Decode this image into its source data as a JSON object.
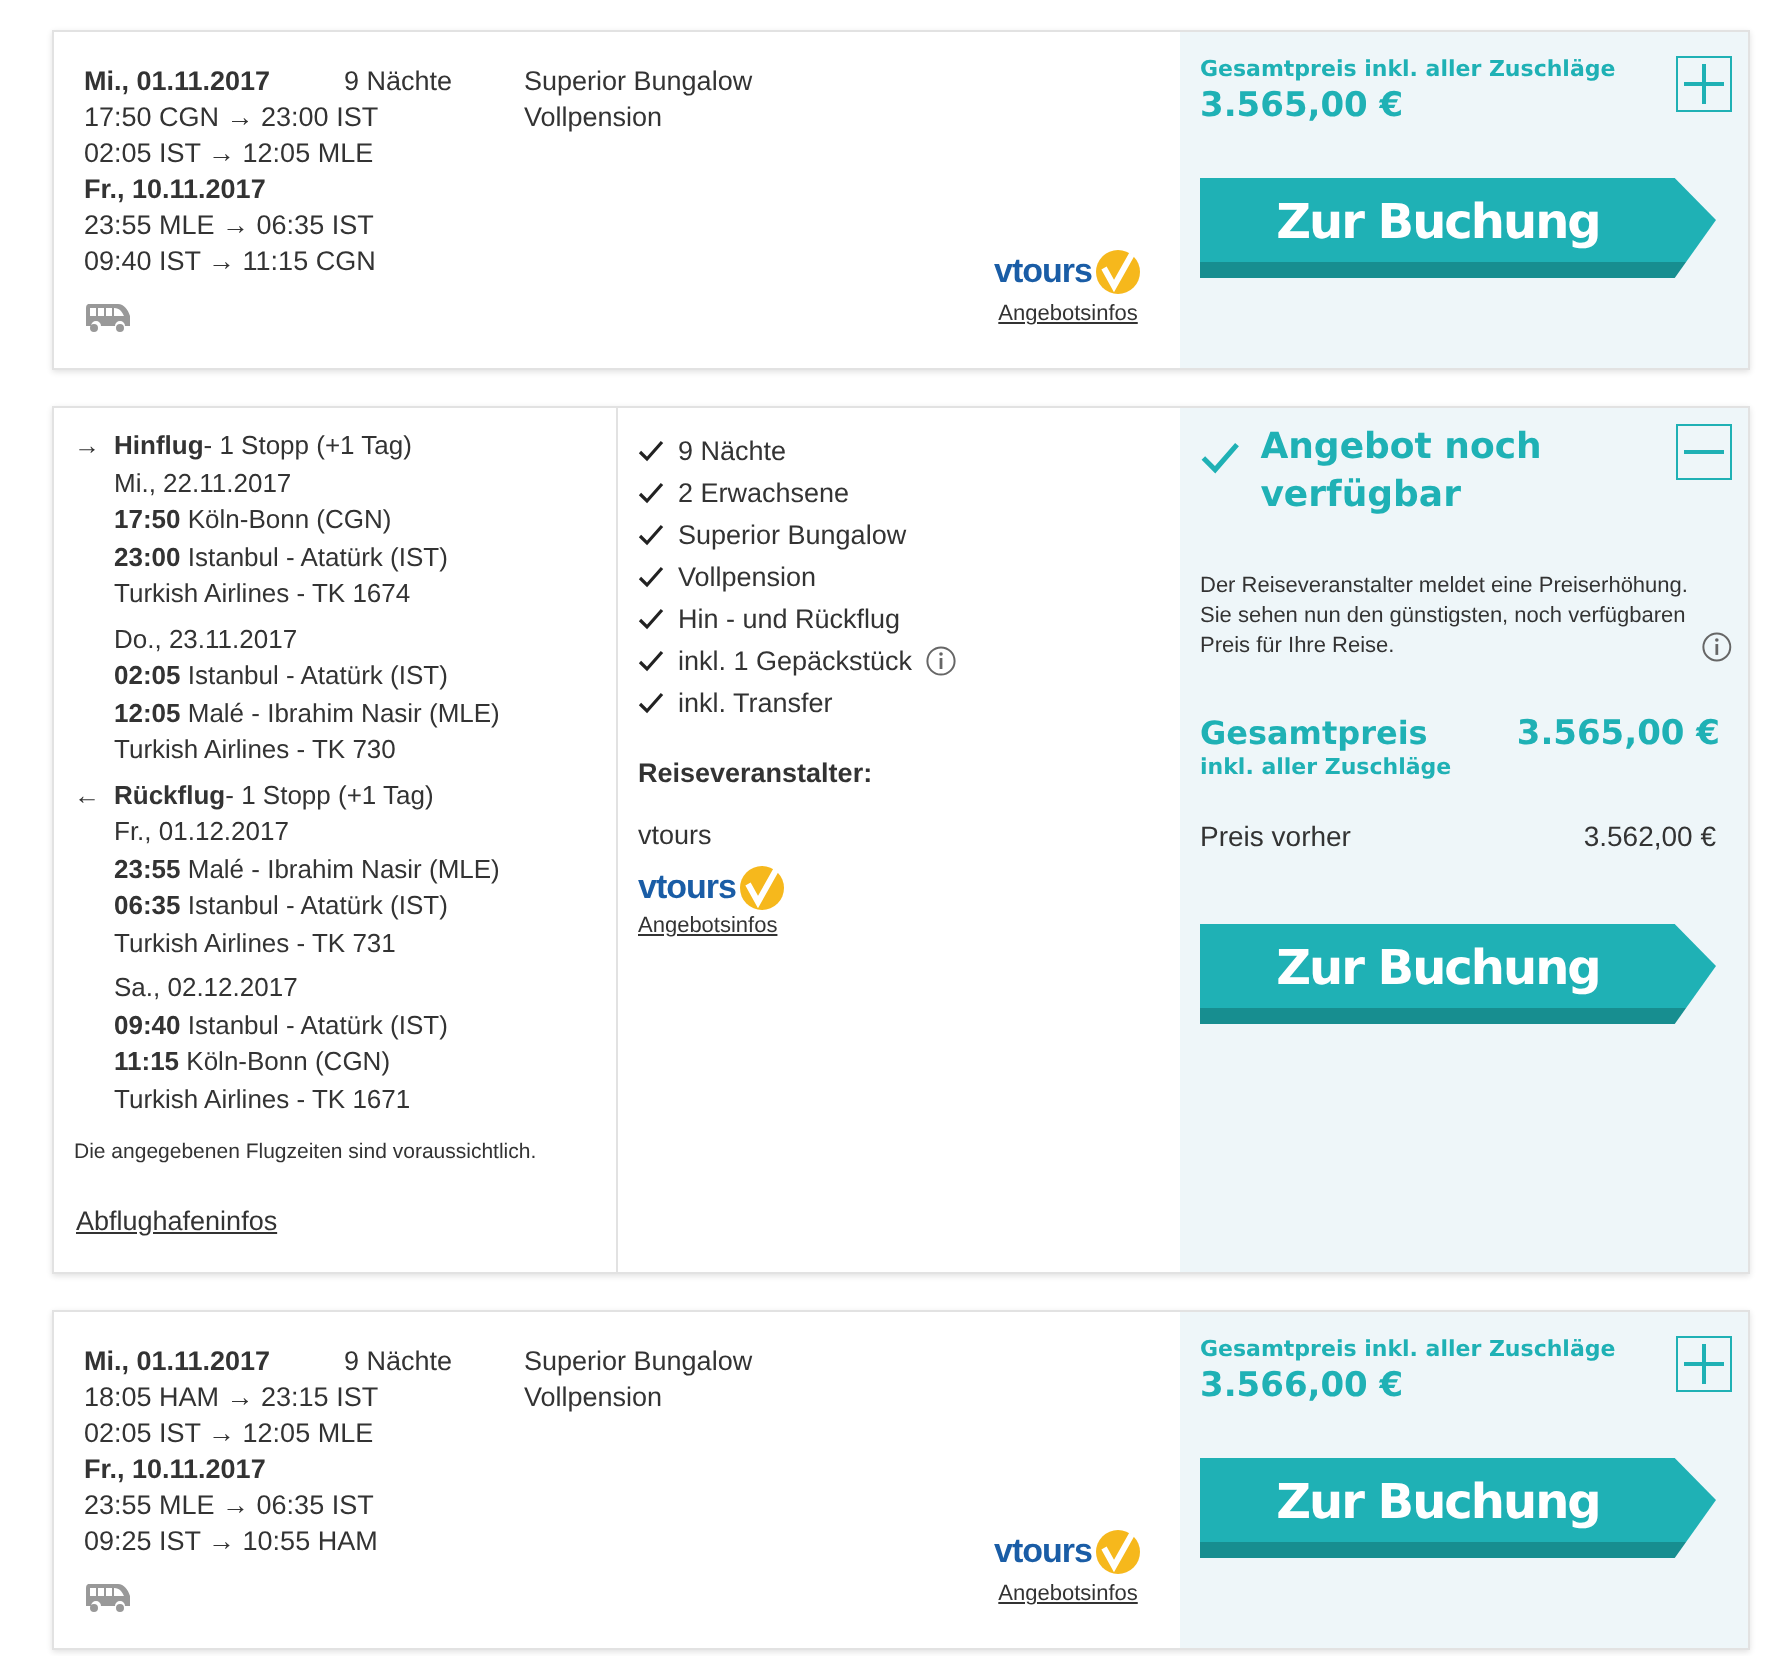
{
  "offers": [
    {
      "kind": "summary",
      "expanded": false,
      "date_out": "Mi., 01.11.2017",
      "nights": "9 Nächte",
      "legs_out": [
        "17:50 CGN → 23:00 IST",
        "02:05 IST → 12:05 MLE"
      ],
      "date_back": "Fr., 10.11.2017",
      "legs_back": [
        "23:55 MLE → 06:35 IST",
        "09:40 IST → 11:15 CGN"
      ],
      "room": "Superior Bungalow",
      "board": "Vollpension",
      "logo_text": "vtours",
      "info_link": "Angebotsinfos",
      "price_label": "Gesamtpreis inkl. aller Zuschläge",
      "price": "3.565,00 €",
      "button": "Zur Buchung"
    },
    {
      "kind": "detail",
      "expanded": true,
      "flights": [
        {
          "arrow": "→",
          "heading": "**Hinflug**- 1 Stopp (+1 Tag)",
          "segments": [
            {
              "date": "Mi., 22.11.2017",
              "lines": [
                "**17:50** Köln-Bonn (CGN)",
                "**23:00** Istanbul - Atatürk (IST)"
              ],
              "airline": "Turkish Airlines - TK 1674"
            },
            {
              "date": "Do., 23.11.2017",
              "lines": [
                "**02:05** Istanbul - Atatürk (IST)",
                "**12:05** Malé - Ibrahim Nasir (MLE)"
              ],
              "airline": "Turkish Airlines - TK 730"
            }
          ]
        },
        {
          "arrow": "←",
          "heading": "**Rückflug**- 1 Stopp (+1 Tag)",
          "segments": [
            {
              "date": "Fr., 01.12.2017",
              "lines": [
                "**23:55** Malé - Ibrahim Nasir (MLE)",
                "**06:35** Istanbul - Atatürk (IST)"
              ],
              "airline": "Turkish Airlines - TK 731"
            },
            {
              "date": "Sa., 02.12.2017",
              "lines": [
                "**09:40** Istanbul - Atatürk (IST)",
                "**11:15** Köln-Bonn (CGN)"
              ],
              "airline": "Turkish Airlines - TK 1671"
            }
          ]
        }
      ],
      "note": "Die angegebenen Flugzeiten sind voraussichtlich.",
      "airport_link": "Abflughafeninfos",
      "features": [
        {
          "text": "9 Nächte",
          "info": false
        },
        {
          "text": "2 Erwachsene",
          "info": false
        },
        {
          "text": "Superior Bungalow",
          "info": false
        },
        {
          "text": "Vollpension",
          "info": false
        },
        {
          "text": "Hin - und Rückflug",
          "info": false
        },
        {
          "text": "inkl. 1 Gepäckstück",
          "info": true
        },
        {
          "text": "inkl. Transfer",
          "info": false
        }
      ],
      "operator_label": "Reiseveranstalter:",
      "operator": "vtours",
      "logo_text": "vtours",
      "info_link": "Angebotsinfos",
      "status": "Angebot noch verfügbar",
      "message": "Der Reiseveranstalter meldet eine Preiserhöhung. Sie sehen nun den günstigsten, noch verfügbaren Preis für Ihre Reise.",
      "price_label": "Gesamtpreis",
      "price_sub": "inkl. aller Zuschläge",
      "price": "3.565,00 €",
      "previous_label": "Preis vorher",
      "previous_price": "3.562,00 €",
      "button": "Zur Buchung"
    },
    {
      "kind": "summary",
      "expanded": false,
      "date_out": "Mi., 01.11.2017",
      "nights": "9 Nächte",
      "legs_out": [
        "18:05 HAM → 23:15 IST",
        "02:05 IST → 12:05 MLE"
      ],
      "date_back": "Fr., 10.11.2017",
      "legs_back": [
        "23:55 MLE → 06:35 IST",
        "09:25 IST → 10:55 HAM"
      ],
      "room": "Superior Bungalow",
      "board": "Vollpension",
      "logo_text": "vtours",
      "info_link": "Angebotsinfos",
      "price_label": "Gesamtpreis inkl. aller Zuschläge",
      "price": "3.566,00 €",
      "button": "Zur Buchung"
    }
  ]
}
